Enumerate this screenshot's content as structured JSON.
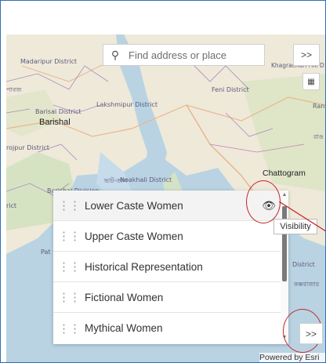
{
  "search": {
    "placeholder": "Find address or place",
    "expand_label": ">>"
  },
  "map_labels": {
    "madaripur": "Madaripur District",
    "khagrachari": "Khagrachari Hill D",
    "feni": "Feni District",
    "lakshmipur": "Lakshmipur District",
    "barishal_district": "Barisal District",
    "barishal": "Barishal",
    "rojpur": "rojpur District",
    "noakhali": "Noakhali District",
    "noakhali_bn": "ভাট-তাল",
    "chattogram": "Chattogram",
    "barishal_division": "Barishal Division",
    "district": "District",
    "coxsbazar_bn": "কক্সবাজার",
    "pat": "Pat",
    "rict": "rict",
    "left_bn": "পাবজ",
    "ran": "Ran",
    "rangamati_bn": "রাঙ"
  },
  "layers": [
    {
      "label": "Lower Caste Women",
      "selected": true
    },
    {
      "label": "Upper Caste Women",
      "selected": false
    },
    {
      "label": "Historical Representation",
      "selected": false
    },
    {
      "label": "Fictional Women",
      "selected": false
    },
    {
      "label": "Mythical Women",
      "selected": false
    }
  ],
  "tooltip": "Visibility",
  "expand_bottom_label": ">>",
  "attribution": "Powered by Esri",
  "icons": {
    "search": "search-icon",
    "drag": "drag-handle-icon",
    "eye": "eye-icon",
    "map_tool": "map-tool-icon"
  },
  "colors": {
    "accent_ring": "#c62828",
    "frame_border": "#2e6fb5",
    "water": "#b9d3e3",
    "land": "#efe9da"
  }
}
